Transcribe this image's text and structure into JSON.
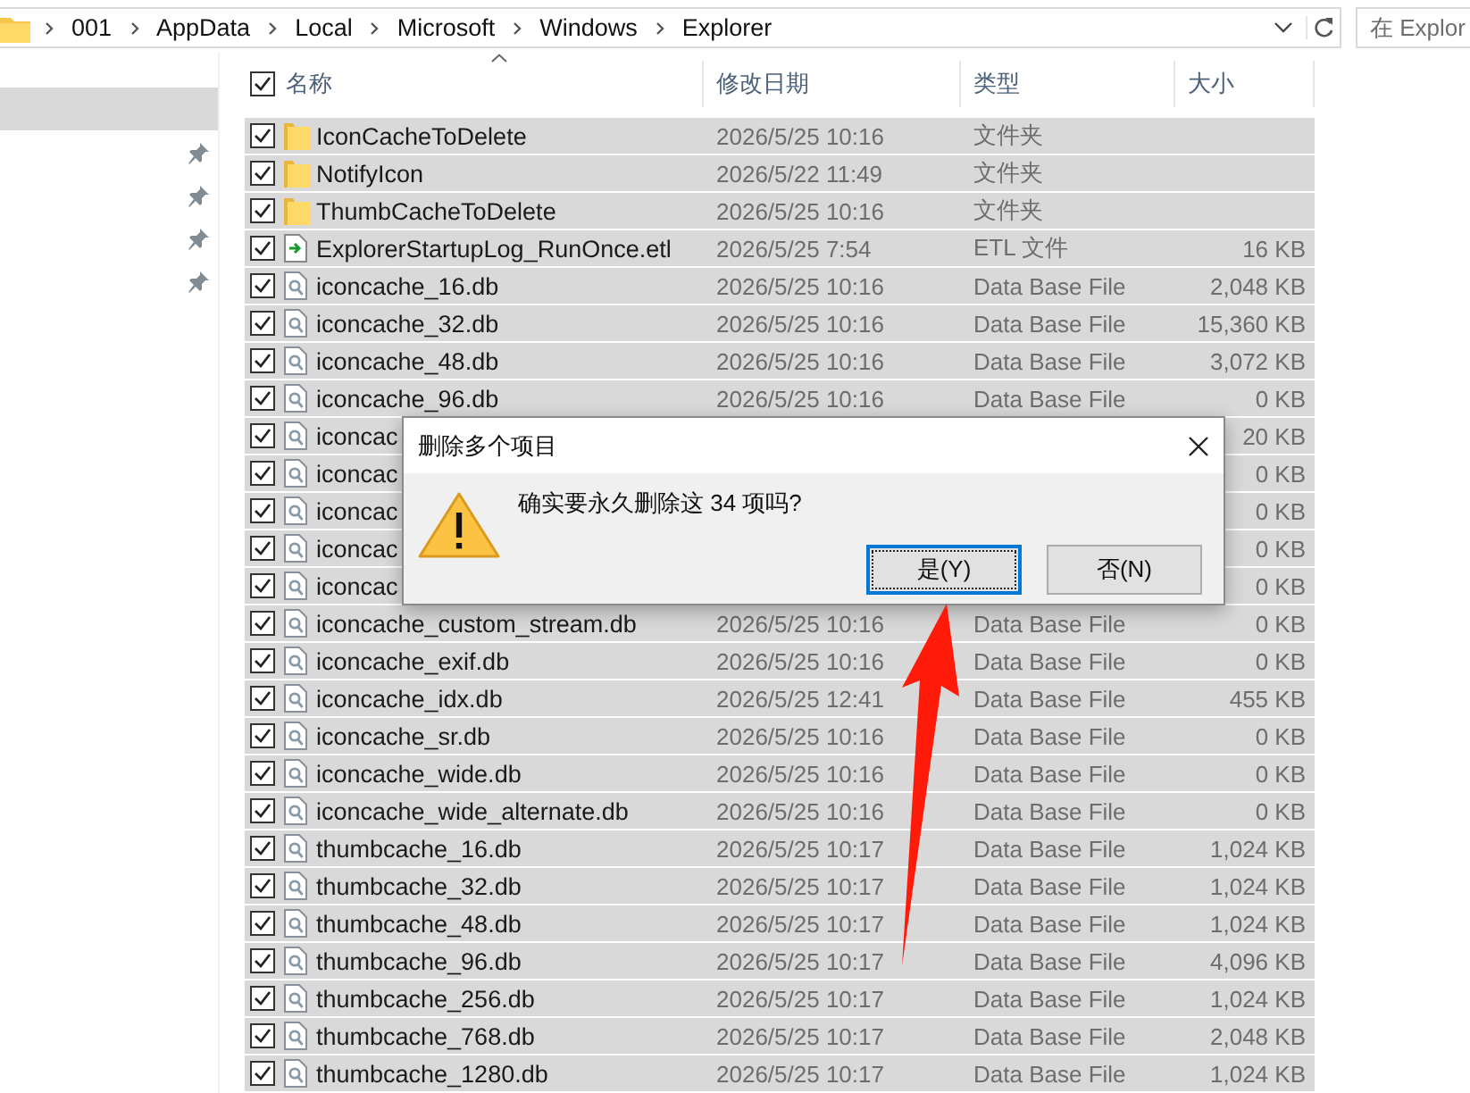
{
  "address_bar": {
    "path": [
      "001",
      "AppData",
      "Local",
      "Microsoft",
      "Windows",
      "Explorer"
    ]
  },
  "search": {
    "placeholder": "在 Explor"
  },
  "sidebar": {
    "items": [
      {
        "selected": true,
        "pinned": false
      },
      {
        "selected": false,
        "pinned": true
      },
      {
        "selected": false,
        "pinned": true
      },
      {
        "selected": false,
        "pinned": true
      },
      {
        "selected": false,
        "pinned": true
      }
    ]
  },
  "table": {
    "header_checked": true,
    "columns": [
      {
        "label": "名称",
        "sorted": true
      },
      {
        "label": "修改日期",
        "sorted": false
      },
      {
        "label": "类型",
        "sorted": false
      },
      {
        "label": "大小",
        "sorted": false
      }
    ],
    "rows": [
      {
        "kind": "folder",
        "name": "IconCacheToDelete",
        "date": "2026/5/25 10:16",
        "type": "文件夹",
        "checked": true,
        "selected": true
      },
      {
        "kind": "folder",
        "name": "NotifyIcon",
        "date": "2026/5/22 11:49",
        "type": "文件夹",
        "checked": true,
        "selected": true
      },
      {
        "kind": "folder",
        "name": "ThumbCacheToDelete",
        "date": "2026/5/25 10:16",
        "type": "文件夹",
        "checked": true,
        "selected": true
      },
      {
        "kind": "log",
        "name": "ExplorerStartupLog_RunOnce.etl",
        "date": "2026/5/25 7:54",
        "type": "ETL 文件",
        "size": "16 KB",
        "checked": true,
        "selected": true
      },
      {
        "kind": "db",
        "name": "iconcache_16.db",
        "date": "2026/5/25 10:16",
        "type": "Data Base File",
        "size": "2,048 KB",
        "checked": true,
        "selected": true
      },
      {
        "kind": "db",
        "name": "iconcache_32.db",
        "date": "2026/5/25 10:16",
        "type": "Data Base File",
        "size": "15,360 KB",
        "checked": true,
        "selected": true
      },
      {
        "kind": "db",
        "name": "iconcache_48.db",
        "date": "2026/5/25 10:16",
        "type": "Data Base File",
        "size": "3,072 KB",
        "checked": true,
        "selected": true
      },
      {
        "kind": "db",
        "name": "iconcache_96.db",
        "date": "2026/5/25 10:16",
        "type": "Data Base File",
        "size": "0 KB",
        "checked": true,
        "selected": true
      },
      {
        "kind": "db",
        "name": "iconcac",
        "size": "20 KB",
        "checked": true,
        "selected": true
      },
      {
        "kind": "db",
        "name": "iconcac",
        "size": "0 KB",
        "checked": true,
        "selected": true
      },
      {
        "kind": "db",
        "name": "iconcac",
        "size": "0 KB",
        "checked": true,
        "selected": true
      },
      {
        "kind": "db",
        "name": "iconcac",
        "size": "0 KB",
        "checked": true,
        "selected": true
      },
      {
        "kind": "db",
        "name": "iconcac",
        "size": "0 KB",
        "checked": true,
        "selected": true
      },
      {
        "kind": "db",
        "name": "iconcache_custom_stream.db",
        "date": "2026/5/25 10:16",
        "type": "Data Base File",
        "size": "0 KB",
        "checked": true,
        "selected": true
      },
      {
        "kind": "db",
        "name": "iconcache_exif.db",
        "date": "2026/5/25 10:16",
        "type": "Data Base File",
        "size": "0 KB",
        "checked": true,
        "selected": true
      },
      {
        "kind": "db",
        "name": "iconcache_idx.db",
        "date": "2026/5/25 12:41",
        "type": "Data Base File",
        "size": "455 KB",
        "checked": true,
        "selected": true
      },
      {
        "kind": "db",
        "name": "iconcache_sr.db",
        "date": "2026/5/25 10:16",
        "type": "Data Base File",
        "size": "0 KB",
        "checked": true,
        "selected": true
      },
      {
        "kind": "db",
        "name": "iconcache_wide.db",
        "date": "2026/5/25 10:16",
        "type": "Data Base File",
        "size": "0 KB",
        "checked": true,
        "selected": true
      },
      {
        "kind": "db",
        "name": "iconcache_wide_alternate.db",
        "date": "2026/5/25 10:16",
        "type": "Data Base File",
        "size": "0 KB",
        "checked": true,
        "selected": true
      },
      {
        "kind": "db",
        "name": "thumbcache_16.db",
        "date": "2026/5/25 10:17",
        "type": "Data Base File",
        "size": "1,024 KB",
        "checked": true,
        "selected": true
      },
      {
        "kind": "db",
        "name": "thumbcache_32.db",
        "date": "2026/5/25 10:17",
        "type": "Data Base File",
        "size": "1,024 KB",
        "checked": true,
        "selected": true
      },
      {
        "kind": "db",
        "name": "thumbcache_48.db",
        "date": "2026/5/25 10:17",
        "type": "Data Base File",
        "size": "1,024 KB",
        "checked": true,
        "selected": true
      },
      {
        "kind": "db",
        "name": "thumbcache_96.db",
        "date": "2026/5/25 10:17",
        "type": "Data Base File",
        "size": "4,096 KB",
        "checked": true,
        "selected": true
      },
      {
        "kind": "db",
        "name": "thumbcache_256.db",
        "date": "2026/5/25 10:17",
        "type": "Data Base File",
        "size": "1,024 KB",
        "checked": true,
        "selected": true
      },
      {
        "kind": "db",
        "name": "thumbcache_768.db",
        "date": "2026/5/25 10:17",
        "type": "Data Base File",
        "size": "2,048 KB",
        "checked": true,
        "selected": true
      },
      {
        "kind": "db",
        "name": "thumbcache_1280.db",
        "date": "2026/5/25 10:17",
        "type": "Data Base File",
        "size": "1,024 KB",
        "checked": true,
        "selected": true
      }
    ]
  },
  "dialog": {
    "title": "删除多个项目",
    "message": "确实要永久删除这 34 项吗?",
    "buttons": [
      {
        "label": "是(Y)",
        "focused": true
      },
      {
        "label": "否(N)",
        "focused": false
      }
    ]
  }
}
